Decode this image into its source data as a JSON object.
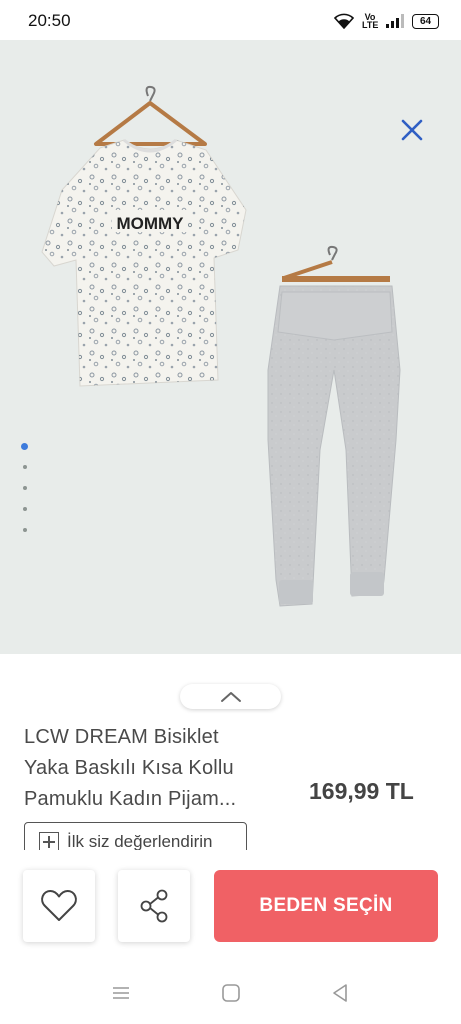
{
  "status_bar": {
    "time": "20:50",
    "volte_label": "Vo LTE",
    "battery": "64",
    "icons": [
      "wifi-icon",
      "volte-icon",
      "signal-icon",
      "battery-icon"
    ]
  },
  "product_image": {
    "print_text": "MOMMY",
    "carousel_count": 5,
    "carousel_active_index": 0
  },
  "product": {
    "title_line1": "LCW DREAM Bisiklet",
    "title_line2": "Yaka Baskılı Kısa Kollu",
    "title_line3": "Pamuklu Kadın Pijam...",
    "price": "169,99 TL",
    "review_label": "İlk siz değerlendirin"
  },
  "actions": {
    "size_button": "BEDEN SEÇİN"
  },
  "colors": {
    "accent": "#f06165",
    "carousel_active": "#3d7bdc",
    "close_icon": "#2f5fc4",
    "image_bg": "#e8ecea"
  },
  "nav_icons": [
    "menu-icon",
    "home-icon",
    "back-icon"
  ]
}
